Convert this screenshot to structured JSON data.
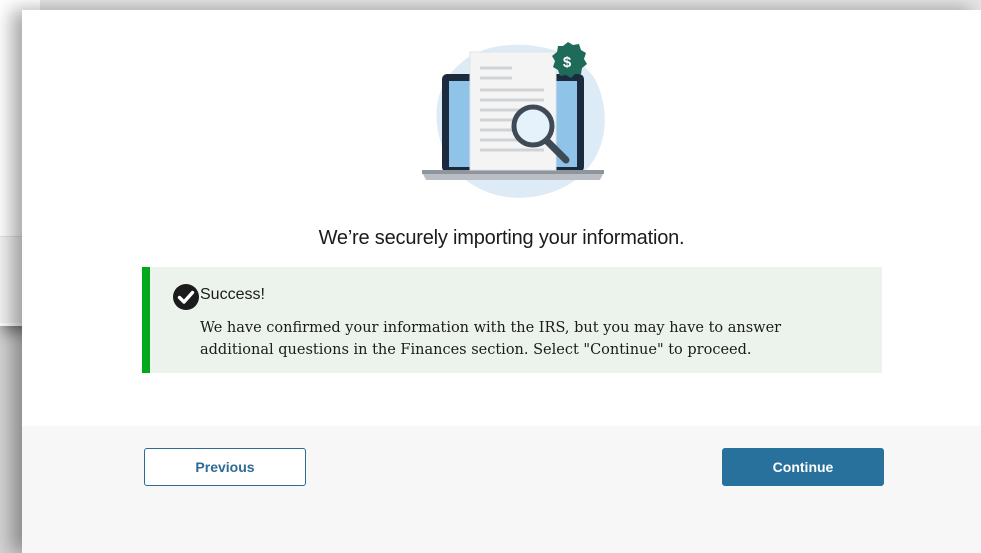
{
  "main": {
    "heading": "We’re securely importing your information."
  },
  "alert": {
    "title": "Success!",
    "body": "We have confirmed your information with the IRS, but you may have to answer additional questions in the Finances section. Select \"Continue\" to proceed."
  },
  "footer": {
    "previous_label": "Previous",
    "continue_label": "Continue"
  },
  "illustration": {
    "badge_symbol": "$"
  },
  "colors": {
    "success_green": "#00a91c",
    "alert_bg": "#ecf3ec",
    "primary": "#28719c",
    "badge": "#1f6b5a"
  }
}
